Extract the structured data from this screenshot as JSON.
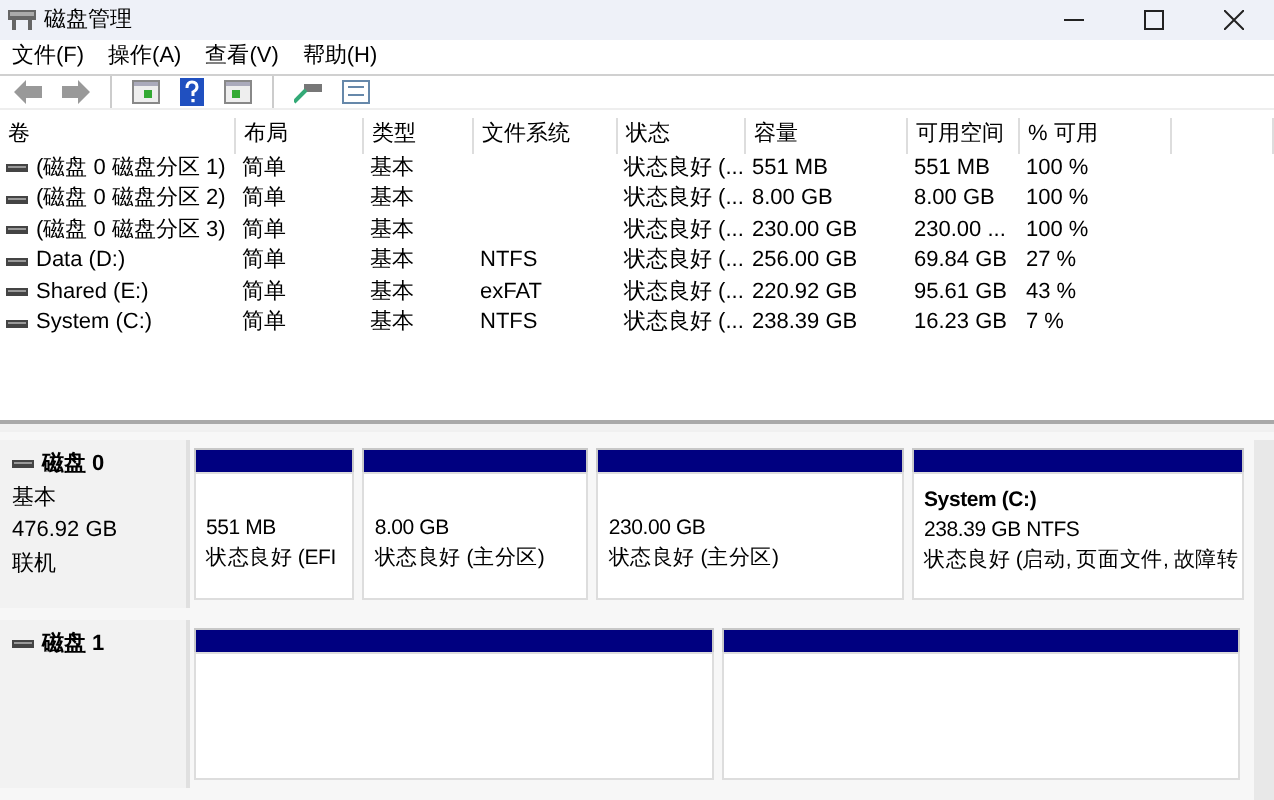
{
  "window": {
    "title": "磁盘管理"
  },
  "menu": [
    "文件(F)",
    "操作(A)",
    "查看(V)",
    "帮助(H)"
  ],
  "volumes": {
    "columns": [
      "卷",
      "布局",
      "类型",
      "文件系统",
      "状态",
      "容量",
      "可用空间",
      "% 可用"
    ],
    "rows": [
      {
        "volume": "(磁盘 0 磁盘分区 1)",
        "layout": "简单",
        "type": "基本",
        "status": "状态良好 (...",
        "capacity": "551 MB",
        "free": "551 MB",
        "pct_free": "100 %"
      },
      {
        "volume": "(磁盘 0 磁盘分区 2)",
        "layout": "简单",
        "type": "基本",
        "status": "状态良好 (...",
        "capacity": "8.00 GB",
        "free": "8.00 GB",
        "pct_free": "100 %"
      },
      {
        "volume": "(磁盘 0 磁盘分区 3)",
        "layout": "简单",
        "type": "基本",
        "status": "状态良好 (...",
        "capacity": "230.00 GB",
        "free": "230.00 ...",
        "pct_free": "100 %"
      },
      {
        "volume": "Data (D:)",
        "layout": "简单",
        "type": "基本",
        "file_system": "NTFS",
        "status": "状态良好 (...",
        "capacity": "256.00 GB",
        "free": "69.84 GB",
        "pct_free": "27 %"
      },
      {
        "volume": "Shared (E:)",
        "layout": "简单",
        "type": "基本",
        "file_system": "exFAT",
        "status": "状态良好 (...",
        "capacity": "220.92 GB",
        "free": "95.61 GB",
        "pct_free": "43 %"
      },
      {
        "volume": "System (C:)",
        "layout": "简单",
        "type": "基本",
        "file_system": "NTFS",
        "status": "状态良好 (...",
        "capacity": "238.39 GB",
        "free": "16.23 GB",
        "pct_free": "7 %"
      }
    ]
  },
  "disks": [
    {
      "name": "磁盘 0",
      "type": "基本",
      "size": "476.92 GB",
      "state": "联机",
      "partitions": [
        {
          "kind": "primary",
          "size": "551 MB",
          "status": "状态良好 (EFI"
        },
        {
          "kind": "primary",
          "size": "8.00 GB",
          "status": "状态良好 (主分区)"
        },
        {
          "kind": "primary",
          "size": "230.00 GB",
          "status": "状态良好 (主分区)"
        },
        {
          "kind": "primary",
          "title": "System  (C:)",
          "size": "238.39 GB NTFS",
          "status": "状态良好 (启动, 页面文件, 故障转"
        }
      ]
    },
    {
      "name": "磁盘 1",
      "partitions": [
        {
          "kind": "primary"
        },
        {
          "kind": "primary"
        }
      ]
    }
  ]
}
